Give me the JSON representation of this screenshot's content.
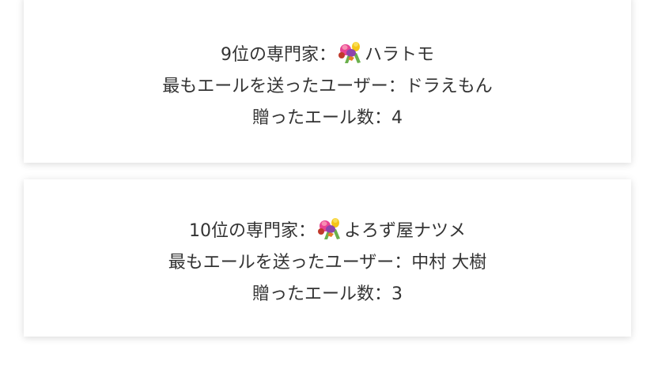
{
  "cards": [
    {
      "rank_prefix": "9位の専門家：",
      "expert_name": "ハラトモ",
      "top_supporter_label": "最もエールを送ったユーザー：",
      "top_supporter_name": "ドラえもん",
      "sent_count_label": "贈ったエール数：",
      "sent_count": "4",
      "icon": "bouquet-icon"
    },
    {
      "rank_prefix": "10位の専門家：",
      "expert_name": "よろず屋ナツメ",
      "top_supporter_label": "最もエールを送ったユーザー：",
      "top_supporter_name": "中村 大樹",
      "sent_count_label": "贈ったエール数：",
      "sent_count": "3",
      "icon": "bouquet-icon"
    }
  ]
}
